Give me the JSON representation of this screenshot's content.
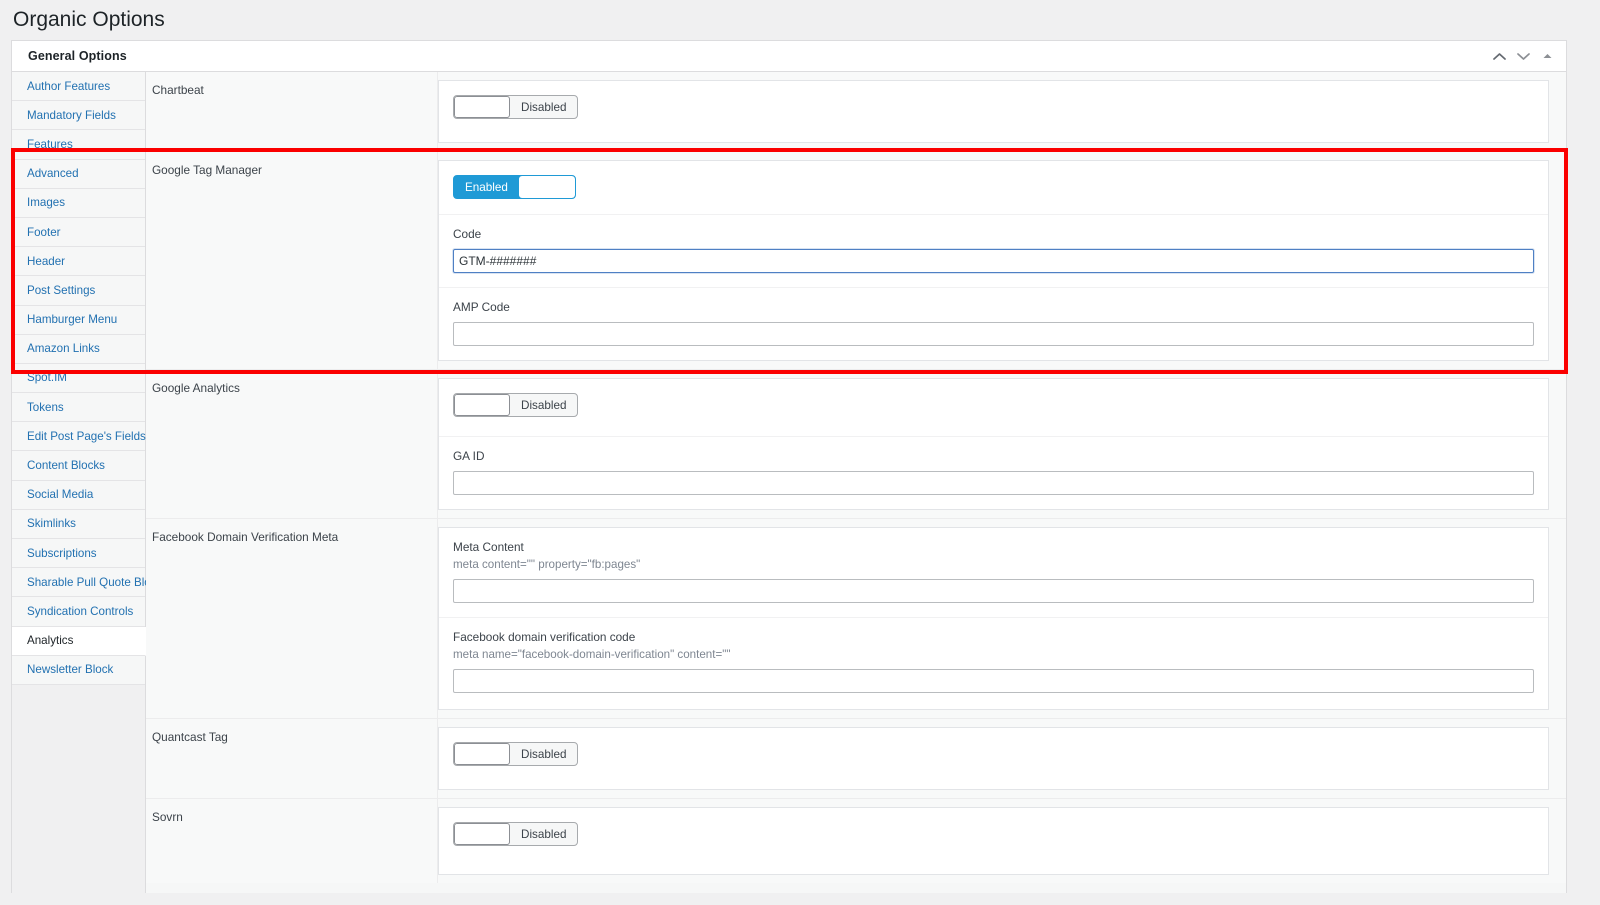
{
  "page": {
    "title": "Organic Options"
  },
  "panel": {
    "title": "General Options",
    "header_buttons": [
      {
        "name": "collapse-up-button",
        "icon": "chevron-up-icon",
        "label": ""
      },
      {
        "name": "collapse-down-button",
        "icon": "chevron-down-icon",
        "label": ""
      },
      {
        "name": "toggle-panel-button",
        "icon": "triangle-up-icon",
        "label": ""
      }
    ]
  },
  "sidebar": {
    "items": [
      {
        "label": "Author Features",
        "active": false
      },
      {
        "label": "Mandatory Fields",
        "active": false
      },
      {
        "label": "Features",
        "active": false
      },
      {
        "label": "Advanced",
        "active": false
      },
      {
        "label": "Images",
        "active": false
      },
      {
        "label": "Footer",
        "active": false
      },
      {
        "label": "Header",
        "active": false
      },
      {
        "label": "Post Settings",
        "active": false
      },
      {
        "label": "Hamburger Menu",
        "active": false
      },
      {
        "label": "Amazon Links",
        "active": false
      },
      {
        "label": "Spot.IM",
        "active": false
      },
      {
        "label": "Tokens",
        "active": false
      },
      {
        "label": "Edit Post Page's Fields",
        "active": false
      },
      {
        "label": "Content Blocks",
        "active": false
      },
      {
        "label": "Social Media",
        "active": false
      },
      {
        "label": "Skimlinks",
        "active": false
      },
      {
        "label": "Subscriptions",
        "active": false
      },
      {
        "label": "Sharable Pull Quote Block",
        "active": false
      },
      {
        "label": "Syndication Controls",
        "active": false
      },
      {
        "label": "Analytics",
        "active": true
      },
      {
        "label": "Newsletter Block",
        "active": false
      }
    ]
  },
  "sections": [
    {
      "name": "chartbeat",
      "label": "Chartbeat",
      "toggle": {
        "state": "off",
        "label": "Disabled"
      },
      "fields": []
    },
    {
      "name": "google-tag-manager",
      "label": "Google Tag Manager",
      "highlighted": true,
      "toggle": {
        "state": "on",
        "label": "Enabled"
      },
      "fields": [
        {
          "name": "gtm-code",
          "label": "Code",
          "hint": "",
          "value": "GTM-#######",
          "placeholder": "",
          "focused": true
        },
        {
          "name": "gtm-amp-code",
          "label": "AMP Code",
          "hint": "",
          "value": "",
          "placeholder": "",
          "focused": false
        }
      ]
    },
    {
      "name": "google-analytics",
      "label": "Google Analytics",
      "toggle": {
        "state": "off",
        "label": "Disabled"
      },
      "fields": [
        {
          "name": "ga-id",
          "label": "GA ID",
          "hint": "",
          "value": "",
          "placeholder": "",
          "focused": false
        }
      ]
    },
    {
      "name": "facebook-domain-verification-meta",
      "label": "Facebook Domain Verification Meta",
      "toggle": null,
      "fields": [
        {
          "name": "fb-meta-content",
          "label": "Meta Content",
          "hint": "meta content=\"\" property=\"fb:pages\"",
          "value": "",
          "placeholder": "",
          "focused": false
        },
        {
          "name": "fb-domain-verification-code",
          "label": "Facebook domain verification code",
          "hint": "meta name=\"facebook-domain-verification\" content=\"\"",
          "value": "",
          "placeholder": "",
          "focused": false
        }
      ]
    },
    {
      "name": "quantcast-tag",
      "label": "Quantcast Tag",
      "toggle": {
        "state": "off",
        "label": "Disabled"
      },
      "fields": []
    },
    {
      "name": "sovrn",
      "label": "Sovrn",
      "toggle": {
        "state": "off",
        "label": "Disabled"
      },
      "fields": []
    }
  ],
  "colors": {
    "accent": "#2271b1",
    "toggle_on": "#1f9ad6",
    "highlight": "#fb0000",
    "page_background": "#f0f0f1",
    "panel_background": "#ffffff"
  }
}
